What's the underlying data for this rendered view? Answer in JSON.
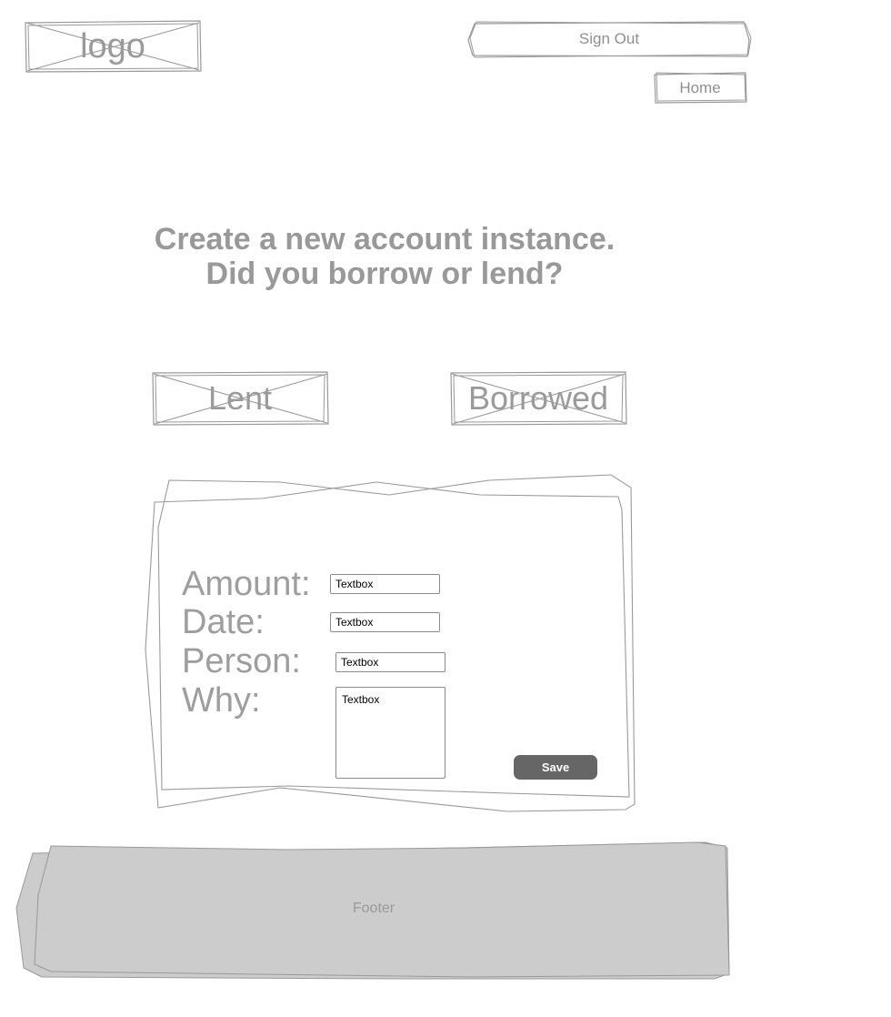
{
  "header": {
    "logo_label": "logo",
    "signout_label": "Sign Out",
    "home_label": "Home"
  },
  "main": {
    "headline_line1": "Create a new account instance.",
    "headline_line2": "Did you borrow or lend?",
    "lent_label": "Lent",
    "borrowed_label": "Borrowed"
  },
  "form": {
    "amount_label": "Amount:",
    "date_label": "Date:",
    "person_label": "Person:",
    "why_label": "Why:",
    "amount_placeholder": "Textbox",
    "date_placeholder": "Textbox",
    "person_placeholder": "Textbox",
    "why_placeholder": "Textbox",
    "save_label": "Save"
  },
  "footer": {
    "label": "Footer"
  },
  "colors": {
    "sketch_stroke": "#999999",
    "save_button": "#666666",
    "footer_fill": "#cccccc"
  }
}
